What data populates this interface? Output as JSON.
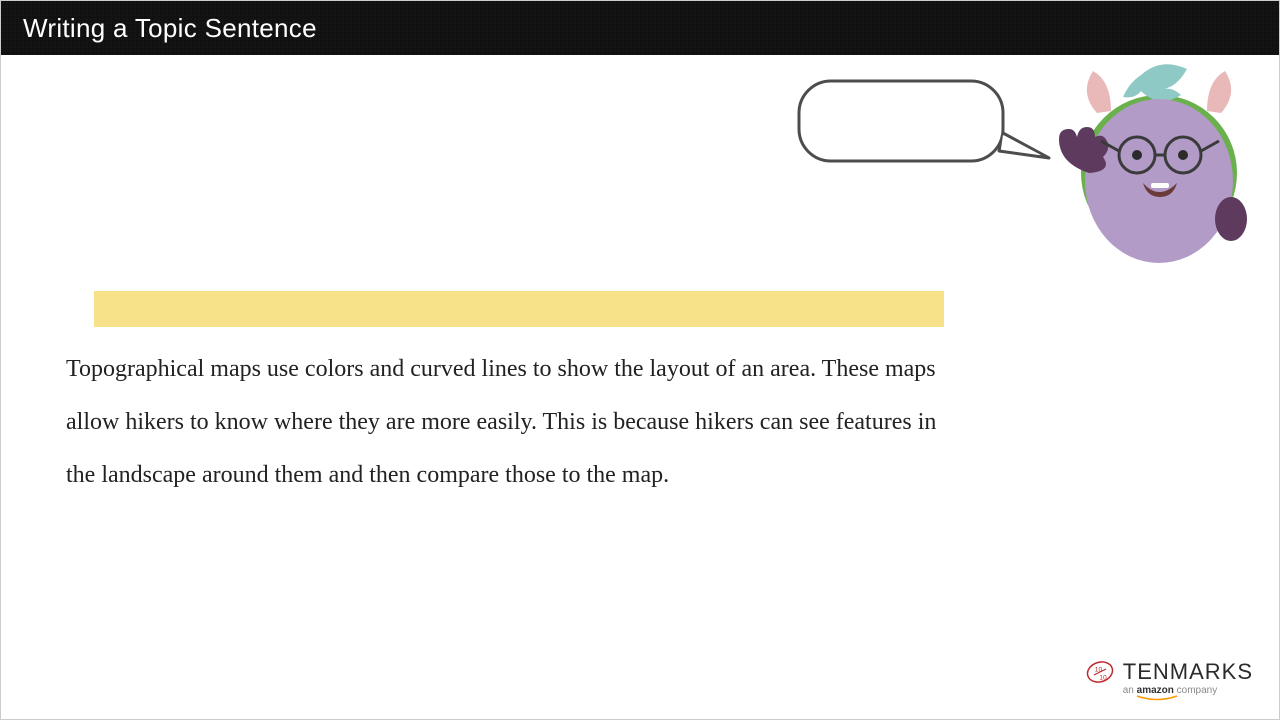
{
  "header": {
    "title": "Writing a Topic Sentence"
  },
  "speech": {
    "text": ""
  },
  "content": {
    "highlighted_blank": "",
    "paragraph": "Topographical maps use colors and curved lines to show the layout of an area.  These maps allow hikers to know where they are more easily.  This is because hikers can see features in the landscape around them and then compare those to the map."
  },
  "logo": {
    "brand": "TENMARKS",
    "subline_prefix": "an ",
    "subline_brand": "amazon",
    "subline_suffix": " company"
  },
  "colors": {
    "highlight": "#f7e28a",
    "header_bg": "#111111",
    "mascot_body": "#b39bc8",
    "mascot_bg": "#6ab04c",
    "logo_red": "#c1272d"
  }
}
